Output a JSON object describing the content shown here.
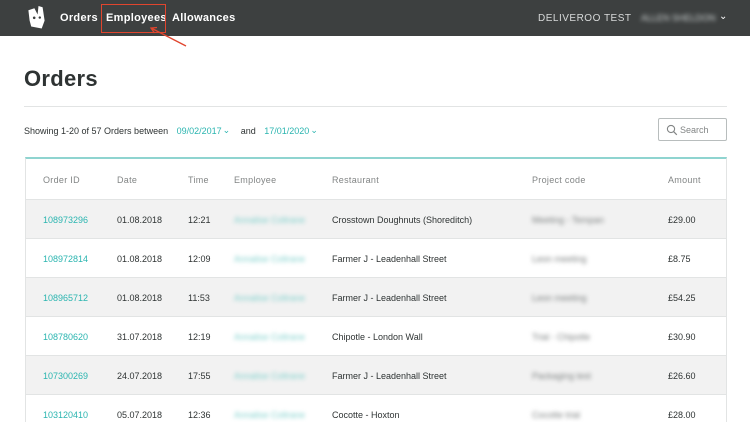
{
  "nav": {
    "links": [
      "Orders",
      "Employees",
      "Allowances"
    ],
    "account_name": "DELIVEROO TEST",
    "user_name": "ALLEN SHELDON",
    "user_chevron": "⌄"
  },
  "page": {
    "title": "Orders"
  },
  "filter": {
    "showing_text": "Showing 1-20 of 57 Orders between",
    "date_from": "09/02/2017",
    "and_text": "and",
    "date_to": "17/01/2020",
    "search_placeholder": "Search"
  },
  "table": {
    "columns": [
      "Order ID",
      "Date",
      "Time",
      "Employee",
      "Restaurant",
      "Project code",
      "Amount"
    ],
    "rows": [
      {
        "order_id": "108973296",
        "date": "01.08.2018",
        "time": "12:21",
        "employee": "Annalise Coltrane",
        "restaurant": "Crosstown Doughnuts (Shoreditch)",
        "project_code": "Meeting - Tempan",
        "amount": "£29.00"
      },
      {
        "order_id": "108972814",
        "date": "01.08.2018",
        "time": "12:09",
        "employee": "Annalise Coltrane",
        "restaurant": "Farmer J - Leadenhall Street",
        "project_code": "Leon meeting",
        "amount": "£8.75"
      },
      {
        "order_id": "108965712",
        "date": "01.08.2018",
        "time": "11:53",
        "employee": "Annalise Coltrane",
        "restaurant": "Farmer J - Leadenhall Street",
        "project_code": "Leon meeting",
        "amount": "£54.25"
      },
      {
        "order_id": "108780620",
        "date": "31.07.2018",
        "time": "12:19",
        "employee": "Annalise Coltrane",
        "restaurant": "Chipotle - London Wall",
        "project_code": "Trial - Chipotle",
        "amount": "£30.90"
      },
      {
        "order_id": "107300269",
        "date": "24.07.2018",
        "time": "17:55",
        "employee": "Annalise Coltrane",
        "restaurant": "Farmer J - Leadenhall Street",
        "project_code": "Packaging test",
        "amount": "£26.60"
      },
      {
        "order_id": "103120410",
        "date": "05.07.2018",
        "time": "12:36",
        "employee": "Annalise Coltrane",
        "restaurant": "Cocotte - Hoxton",
        "project_code": "Cocotte trial",
        "amount": "£28.00"
      }
    ]
  },
  "colors": {
    "navbar": "#3d4040",
    "accent": "#2bb5b0",
    "annotation": "#e0452e"
  },
  "icons": [
    "deliveroo-logo",
    "search-icon",
    "chevron-down-icon"
  ]
}
